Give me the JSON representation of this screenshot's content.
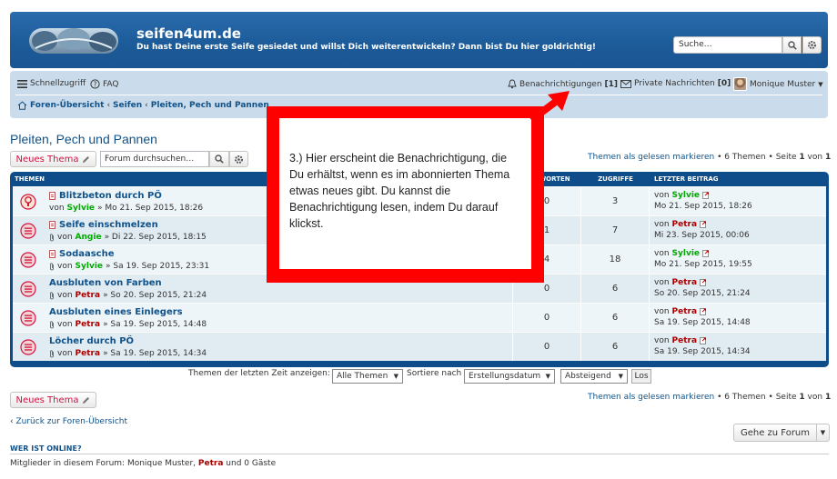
{
  "colors": {
    "header_bg": "#1c5a98",
    "nav_bg": "#cadceb",
    "link": "#105289",
    "new_topic": "#d31141",
    "annotation_red": "#ff0000",
    "user_green": "#00aa00",
    "user_red": "#aa0000"
  },
  "header": {
    "site_title": "seifen4um.de",
    "site_desc": "Du hast Deine erste Seife gesiedet und willst Dich weiterentwickeln? Dann bist Du hier goldrichtig!",
    "search_placeholder": "Suche…",
    "search_icon": "search-icon",
    "advanced_icon": "gear-icon"
  },
  "nav": {
    "quicklinks": "Schnellzugriff",
    "faq": "FAQ",
    "notifications": "Benachrichtigungen",
    "notifications_count": "[1]",
    "pm": "Private Nachrichten",
    "pm_count": "[0]",
    "user": "Monique Muster",
    "breadcrumb": [
      "Foren-Übersicht",
      "Seifen",
      "Pleiten, Pech und Pannen"
    ]
  },
  "forum": {
    "title": "Pleiten, Pech und Pannen",
    "new_topic": "Neues Thema",
    "search_placeholder": "Forum durchsuchen…",
    "mark_read": "Themen als gelesen markieren",
    "topic_count": "6 Themen",
    "page_label": "Seite",
    "page_current": "1",
    "page_of": "von",
    "page_total": "1",
    "bullet": "•"
  },
  "table": {
    "headers": {
      "topics": "Themen",
      "replies": "Antworten",
      "views": "Zugriffe",
      "last_post": "Letzter Beitrag"
    },
    "rows": [
      {
        "title": "Blitzbeton durch PÖ",
        "by": "von",
        "author": "Sylvie",
        "author_color": "green",
        "date": "» Mo 21. Sep 2015, 18:26",
        "replies": "0",
        "views": "3",
        "last_by": "von",
        "last_user": "Sylvie",
        "last_color": "green",
        "last_date": "Mo 21. Sep 2015, 18:26",
        "unread": true
      },
      {
        "title": "Seife einschmelzen",
        "by": "von",
        "author": "Angie",
        "author_color": "green",
        "date": "» Di 22. Sep 2015, 18:15",
        "replies": "1",
        "views": "7",
        "last_by": "von",
        "last_user": "Petra",
        "last_color": "red",
        "last_date": "Mi 23. Sep 2015, 00:06",
        "unread": false
      },
      {
        "title": "Sodaasche",
        "by": "von",
        "author": "Sylvie",
        "author_color": "green",
        "date": "» Sa 19. Sep 2015, 23:31",
        "replies": "4",
        "views": "18",
        "last_by": "von",
        "last_user": "Sylvie",
        "last_color": "green",
        "last_date": "Mo 21. Sep 2015, 19:55",
        "unread": false
      },
      {
        "title": "Ausbluten von Farben",
        "by": "von",
        "author": "Petra",
        "author_color": "red",
        "date": "» So 20. Sep 2015, 21:24",
        "replies": "0",
        "views": "6",
        "last_by": "von",
        "last_user": "Petra",
        "last_color": "red",
        "last_date": "So 20. Sep 2015, 21:24",
        "unread": false
      },
      {
        "title": "Ausbluten eines Einlegers",
        "by": "von",
        "author": "Petra",
        "author_color": "red",
        "date": "» Sa 19. Sep 2015, 14:48",
        "replies": "0",
        "views": "6",
        "last_by": "von",
        "last_user": "Petra",
        "last_color": "red",
        "last_date": "Sa 19. Sep 2015, 14:48",
        "unread": false
      },
      {
        "title": "Löcher durch PÖ",
        "by": "von",
        "author": "Petra",
        "author_color": "red",
        "date": "» Sa 19. Sep 2015, 14:34",
        "replies": "0",
        "views": "6",
        "last_by": "von",
        "last_user": "Petra",
        "last_color": "red",
        "last_date": "Sa 19. Sep 2015, 14:34",
        "unread": false
      }
    ]
  },
  "sorting": {
    "show_label": "Themen der letzten Zeit anzeigen:",
    "show_value": "Alle Themen",
    "sort_label": "Sortiere nach",
    "sort_value": "Erstellungsdatum",
    "order_value": "Absteigend",
    "go": "Los"
  },
  "footer": {
    "back": "Zurück zur Foren-Übersicht",
    "back_icon": "‹",
    "jump": "Gehe zu Forum",
    "online_title": "Wer ist online?",
    "online_prefix": "Mitglieder in diesem Forum: Monique Muster,",
    "online_user": "Petra",
    "online_suffix": "und 0 Gäste"
  },
  "annotation": {
    "text": "3.) Hier erscheint die Benachrichtigung, die Du erhältst, wenn es im abonnierten Thema etwas neues gibt. Du kannst die Benachrichtigung lesen, indem Du darauf klickst."
  }
}
